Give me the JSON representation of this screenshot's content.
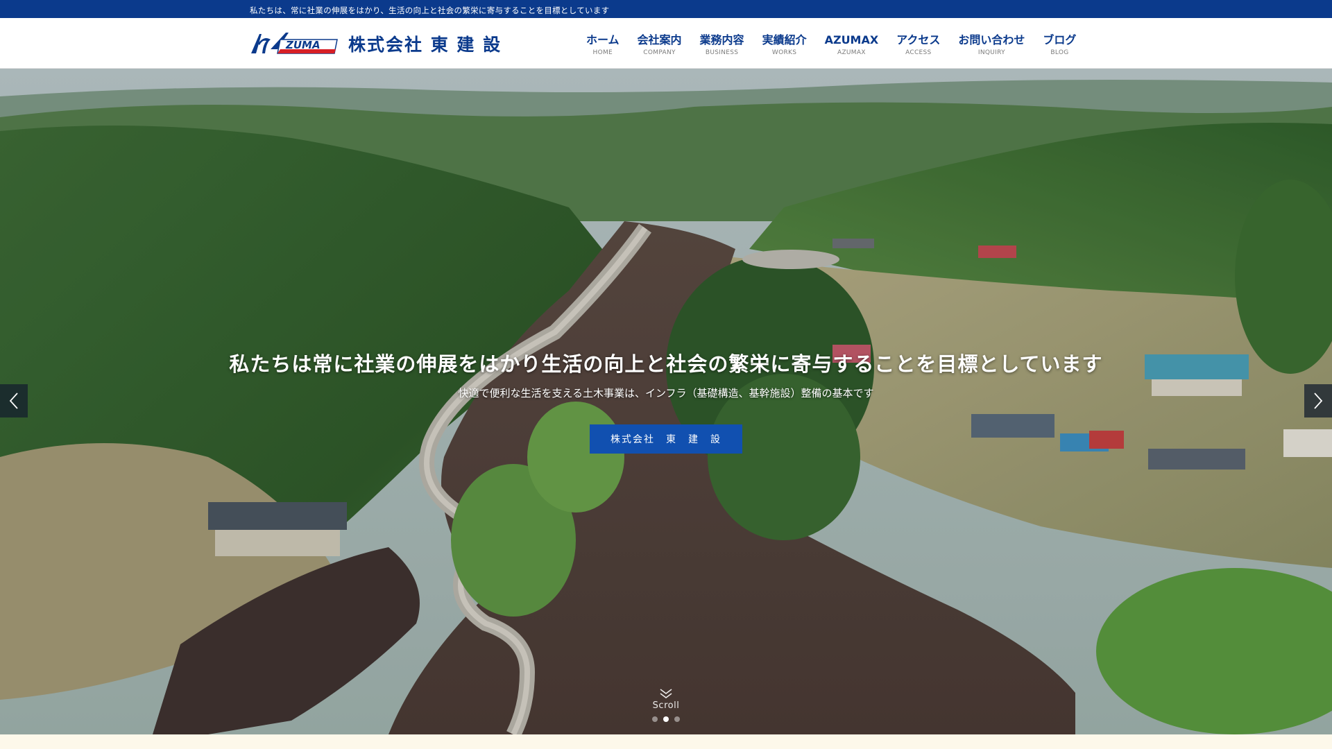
{
  "topbar": {
    "tagline": "私たちは、常に社業の伸展をはかり、生活の向上と社会の繁栄に寄与することを目標としています"
  },
  "header": {
    "logo_mark_text": "ZUMA",
    "company_name": "株式会社 東 建 設",
    "brand_color": "#0b3a8c"
  },
  "nav": [
    {
      "ja": "ホーム",
      "en": "HOME"
    },
    {
      "ja": "会社案内",
      "en": "COMPANY"
    },
    {
      "ja": "業務内容",
      "en": "BUSINESS"
    },
    {
      "ja": "実績紹介",
      "en": "WORKS"
    },
    {
      "ja": "AZUMAX",
      "en": "AZUMAX"
    },
    {
      "ja": "アクセス",
      "en": "ACCESS"
    },
    {
      "ja": "お問い合わせ",
      "en": "INQUIRY"
    },
    {
      "ja": "ブログ",
      "en": "BLOG"
    }
  ],
  "hero": {
    "title": "私たちは常に社業の伸展をはかり生活の向上と社会の繁栄に寄与することを目標としています",
    "subtitle": "快適で便利な生活を支える土木事業は、インフラ（基礎構造、基幹施設）整備の基本です",
    "button_label": "株式会社　東　建　設",
    "button_color": "#1150b0",
    "scroll_label": "Scroll",
    "slides_total": 3,
    "active_slide": 1,
    "prev_icon": "chevron-left-icon",
    "next_icon": "chevron-right-icon"
  }
}
